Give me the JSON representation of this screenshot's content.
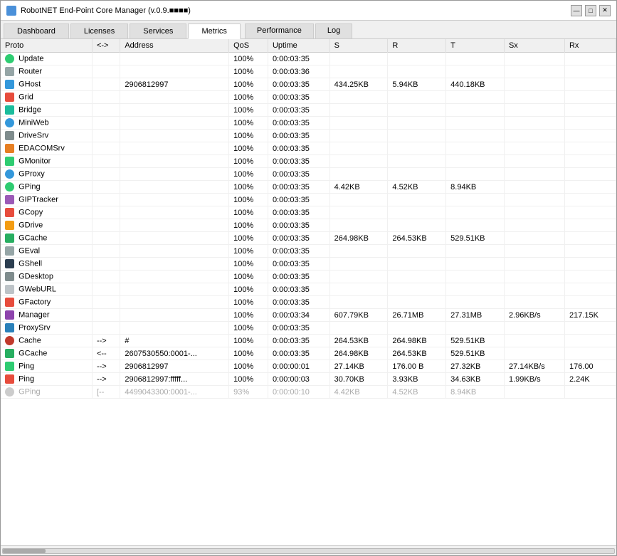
{
  "window": {
    "title": "RobotNET End-Point Core Manager (v.0.9.■■■■)",
    "controls": [
      "minimize",
      "maximize",
      "close"
    ]
  },
  "nav_tabs": [
    {
      "label": "Dashboard",
      "active": false
    },
    {
      "label": "Licenses",
      "active": false
    },
    {
      "label": "Services",
      "active": false
    },
    {
      "label": "Metrics",
      "active": true
    }
  ],
  "sub_tabs": [
    {
      "label": "Performance",
      "active": false
    },
    {
      "label": "Log",
      "active": false
    }
  ],
  "table": {
    "headers": [
      "Proto",
      "<->",
      "Address",
      "QoS",
      "Uptime",
      "S",
      "R",
      "T",
      "Sx",
      "Rx"
    ],
    "rows": [
      {
        "icon": "update",
        "proto": "Update",
        "arrow": "",
        "address": "",
        "qos": "100%",
        "uptime": "0:00:03:35",
        "s": "",
        "r": "",
        "t": "",
        "sx": "",
        "rx": "",
        "dim": false
      },
      {
        "icon": "router",
        "proto": "Router",
        "arrow": "",
        "address": "",
        "qos": "100%",
        "uptime": "0:00:03:36",
        "s": "",
        "r": "",
        "t": "",
        "sx": "",
        "rx": "",
        "dim": false
      },
      {
        "icon": "ghost",
        "proto": "GHost",
        "arrow": "",
        "address": "2906812997",
        "qos": "100%",
        "uptime": "0:00:03:35",
        "s": "434.25KB",
        "r": "5.94KB",
        "t": "440.18KB",
        "sx": "",
        "rx": "",
        "dim": false
      },
      {
        "icon": "grid",
        "proto": "Grid",
        "arrow": "",
        "address": "",
        "qos": "100%",
        "uptime": "0:00:03:35",
        "s": "",
        "r": "",
        "t": "",
        "sx": "",
        "rx": "",
        "dim": false
      },
      {
        "icon": "bridge",
        "proto": "Bridge",
        "arrow": "",
        "address": "",
        "qos": "100%",
        "uptime": "0:00:03:35",
        "s": "",
        "r": "",
        "t": "",
        "sx": "",
        "rx": "",
        "dim": false
      },
      {
        "icon": "miniweb",
        "proto": "MiniWeb",
        "arrow": "",
        "address": "",
        "qos": "100%",
        "uptime": "0:00:03:35",
        "s": "",
        "r": "",
        "t": "",
        "sx": "",
        "rx": "",
        "dim": false
      },
      {
        "icon": "drivesrv",
        "proto": "DriveSrv",
        "arrow": "",
        "address": "",
        "qos": "100%",
        "uptime": "0:00:03:35",
        "s": "",
        "r": "",
        "t": "",
        "sx": "",
        "rx": "",
        "dim": false
      },
      {
        "icon": "edacomsrv",
        "proto": "EDACOMSrv",
        "arrow": "",
        "address": "",
        "qos": "100%",
        "uptime": "0:00:03:35",
        "s": "",
        "r": "",
        "t": "",
        "sx": "",
        "rx": "",
        "dim": false
      },
      {
        "icon": "gmonitor",
        "proto": "GMonitor",
        "arrow": "",
        "address": "",
        "qos": "100%",
        "uptime": "0:00:03:35",
        "s": "",
        "r": "",
        "t": "",
        "sx": "",
        "rx": "",
        "dim": false
      },
      {
        "icon": "gproxy",
        "proto": "GProxy",
        "arrow": "",
        "address": "",
        "qos": "100%",
        "uptime": "0:00:03:35",
        "s": "",
        "r": "",
        "t": "",
        "sx": "",
        "rx": "",
        "dim": false
      },
      {
        "icon": "gping",
        "proto": "GPing",
        "arrow": "",
        "address": "",
        "qos": "100%",
        "uptime": "0:00:03:35",
        "s": "4.42KB",
        "r": "4.52KB",
        "t": "8.94KB",
        "sx": "",
        "rx": "",
        "dim": false
      },
      {
        "icon": "giptracker",
        "proto": "GIPTracker",
        "arrow": "",
        "address": "",
        "qos": "100%",
        "uptime": "0:00:03:35",
        "s": "",
        "r": "",
        "t": "",
        "sx": "",
        "rx": "",
        "dim": false
      },
      {
        "icon": "gcopy",
        "proto": "GCopy",
        "arrow": "",
        "address": "",
        "qos": "100%",
        "uptime": "0:00:03:35",
        "s": "",
        "r": "",
        "t": "",
        "sx": "",
        "rx": "",
        "dim": false
      },
      {
        "icon": "gdrive",
        "proto": "GDrive",
        "arrow": "",
        "address": "",
        "qos": "100%",
        "uptime": "0:00:03:35",
        "s": "",
        "r": "",
        "t": "",
        "sx": "",
        "rx": "",
        "dim": false
      },
      {
        "icon": "gcache",
        "proto": "GCache",
        "arrow": "",
        "address": "",
        "qos": "100%",
        "uptime": "0:00:03:35",
        "s": "264.98KB",
        "r": "264.53KB",
        "t": "529.51KB",
        "sx": "",
        "rx": "",
        "dim": false
      },
      {
        "icon": "geval",
        "proto": "GEval",
        "arrow": "",
        "address": "",
        "qos": "100%",
        "uptime": "0:00:03:35",
        "s": "",
        "r": "",
        "t": "",
        "sx": "",
        "rx": "",
        "dim": false
      },
      {
        "icon": "gshell",
        "proto": "GShell",
        "arrow": "",
        "address": "",
        "qos": "100%",
        "uptime": "0:00:03:35",
        "s": "",
        "r": "",
        "t": "",
        "sx": "",
        "rx": "",
        "dim": false
      },
      {
        "icon": "gdesktop",
        "proto": "GDesktop",
        "arrow": "",
        "address": "",
        "qos": "100%",
        "uptime": "0:00:03:35",
        "s": "",
        "r": "",
        "t": "",
        "sx": "",
        "rx": "",
        "dim": false
      },
      {
        "icon": "gweburl",
        "proto": "GWebURL",
        "arrow": "",
        "address": "",
        "qos": "100%",
        "uptime": "0:00:03:35",
        "s": "",
        "r": "",
        "t": "",
        "sx": "",
        "rx": "",
        "dim": false
      },
      {
        "icon": "gfactory",
        "proto": "GFactory",
        "arrow": "",
        "address": "",
        "qos": "100%",
        "uptime": "0:00:03:35",
        "s": "",
        "r": "",
        "t": "",
        "sx": "",
        "rx": "",
        "dim": false
      },
      {
        "icon": "manager",
        "proto": "Manager",
        "arrow": "",
        "address": "",
        "qos": "100%",
        "uptime": "0:00:03:34",
        "s": "607.79KB",
        "r": "26.71MB",
        "t": "27.31MB",
        "sx": "2.96KB/s",
        "rx": "217.15K",
        "dim": false
      },
      {
        "icon": "proxysrv",
        "proto": "ProxySrv",
        "arrow": "",
        "address": "",
        "qos": "100%",
        "uptime": "0:00:03:35",
        "s": "",
        "r": "",
        "t": "",
        "sx": "",
        "rx": "",
        "dim": false
      },
      {
        "icon": "cache",
        "proto": "Cache",
        "arrow": "-->",
        "address": "#",
        "qos": "100%",
        "uptime": "0:00:03:35",
        "s": "264.53KB",
        "r": "264.98KB",
        "t": "529.51KB",
        "sx": "",
        "rx": "",
        "dim": false
      },
      {
        "icon": "gcache2",
        "proto": "GCache",
        "arrow": "<--",
        "address": "2607530550:0001-...",
        "qos": "100%",
        "uptime": "0:00:03:35",
        "s": "264.98KB",
        "r": "264.53KB",
        "t": "529.51KB",
        "sx": "",
        "rx": "",
        "dim": false
      },
      {
        "icon": "ping",
        "proto": "Ping",
        "arrow": "-->",
        "address": "2906812997",
        "qos": "100%",
        "uptime": "0:00:00:01",
        "s": "27.14KB",
        "r": "176.00 B",
        "t": "27.32KB",
        "sx": "27.14KB/s",
        "rx": "176.00",
        "dim": false
      },
      {
        "icon": "ping2",
        "proto": "Ping",
        "arrow": "-->",
        "address": "2906812997:fffff...",
        "qos": "100%",
        "uptime": "0:00:00:03",
        "s": "30.70KB",
        "r": "3.93KB",
        "t": "34.63KB",
        "sx": "1.99KB/s",
        "rx": "2.24K",
        "dim": false
      },
      {
        "icon": "gpingdim",
        "proto": "GPing",
        "arrow": "[--",
        "address": "4499043300:0001-...",
        "qos": "93%",
        "uptime": "0:00:00:10",
        "s": "4.42KB",
        "r": "4.52KB",
        "t": "8.94KB",
        "sx": "",
        "rx": "",
        "dim": true
      }
    ]
  }
}
